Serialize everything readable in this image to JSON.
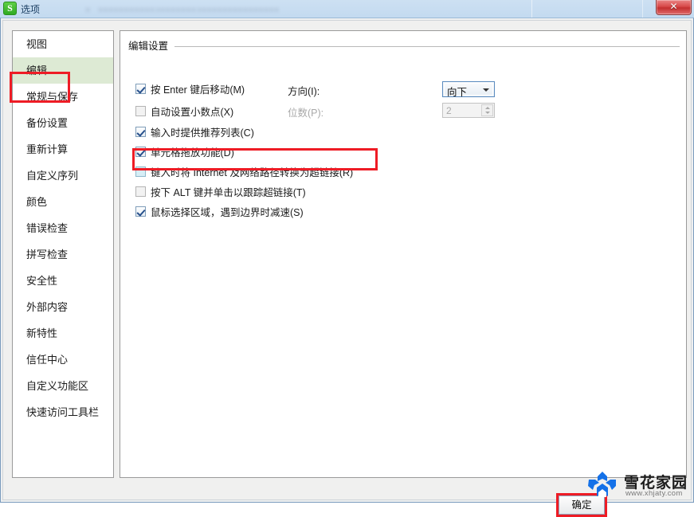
{
  "window": {
    "title": "选项",
    "app_icon": "wps-spreadsheet-icon",
    "close_label": "✕",
    "backdrop_blurred_text": "。 。。。。。。。。。。。，。。。。。。。，。。。。。。。。。。。。。。。"
  },
  "sidebar": {
    "items": [
      {
        "label": "视图",
        "selected": false
      },
      {
        "label": "编辑",
        "selected": true
      },
      {
        "label": "常规与保存",
        "selected": false
      },
      {
        "label": "备份设置",
        "selected": false
      },
      {
        "label": "重新计算",
        "selected": false
      },
      {
        "label": "自定义序列",
        "selected": false
      },
      {
        "label": "颜色",
        "selected": false
      },
      {
        "label": "错误检查",
        "selected": false
      },
      {
        "label": "拼写检查",
        "selected": false
      },
      {
        "label": "安全性",
        "selected": false
      },
      {
        "label": "外部内容",
        "selected": false
      },
      {
        "label": "新特性",
        "selected": false
      },
      {
        "label": "信任中心",
        "selected": false
      },
      {
        "label": "自定义功能区",
        "selected": false
      },
      {
        "label": "快速访问工具栏",
        "selected": false
      }
    ]
  },
  "panel": {
    "group_title": "编辑设置",
    "checkboxes": [
      {
        "label": "按 Enter 键后移动(M)",
        "state": "checked"
      },
      {
        "label": "自动设置小数点(X)",
        "state": "unchecked"
      },
      {
        "label": "输入时提供推荐列表(C)",
        "state": "checked"
      },
      {
        "label": "单元格拖放功能(D)",
        "state": "checked"
      },
      {
        "label": "键入时将 Internet 及网络路径转换为超链接(R)",
        "state": "focused"
      },
      {
        "label": "按下 ALT 键并单击以跟踪超链接(T)",
        "state": "unchecked"
      },
      {
        "label": "鼠标选择区域，遇到边界时减速(S)",
        "state": "checked"
      }
    ],
    "direction": {
      "label": "方向(I):",
      "value": "向下"
    },
    "decimals": {
      "label": "位数(P):",
      "value": "2",
      "enabled": false
    }
  },
  "footer": {
    "ok_label": "确定"
  },
  "watermark": {
    "name": "雪花家园",
    "url": "www.xhjaty.com",
    "logo": "snowflake-logo",
    "color": "#1471e8"
  },
  "annotations": {
    "color": "#ee1c25",
    "targets": [
      "sidebar-item-edit",
      "hyperlink-checkbox-row",
      "ok-button"
    ]
  }
}
